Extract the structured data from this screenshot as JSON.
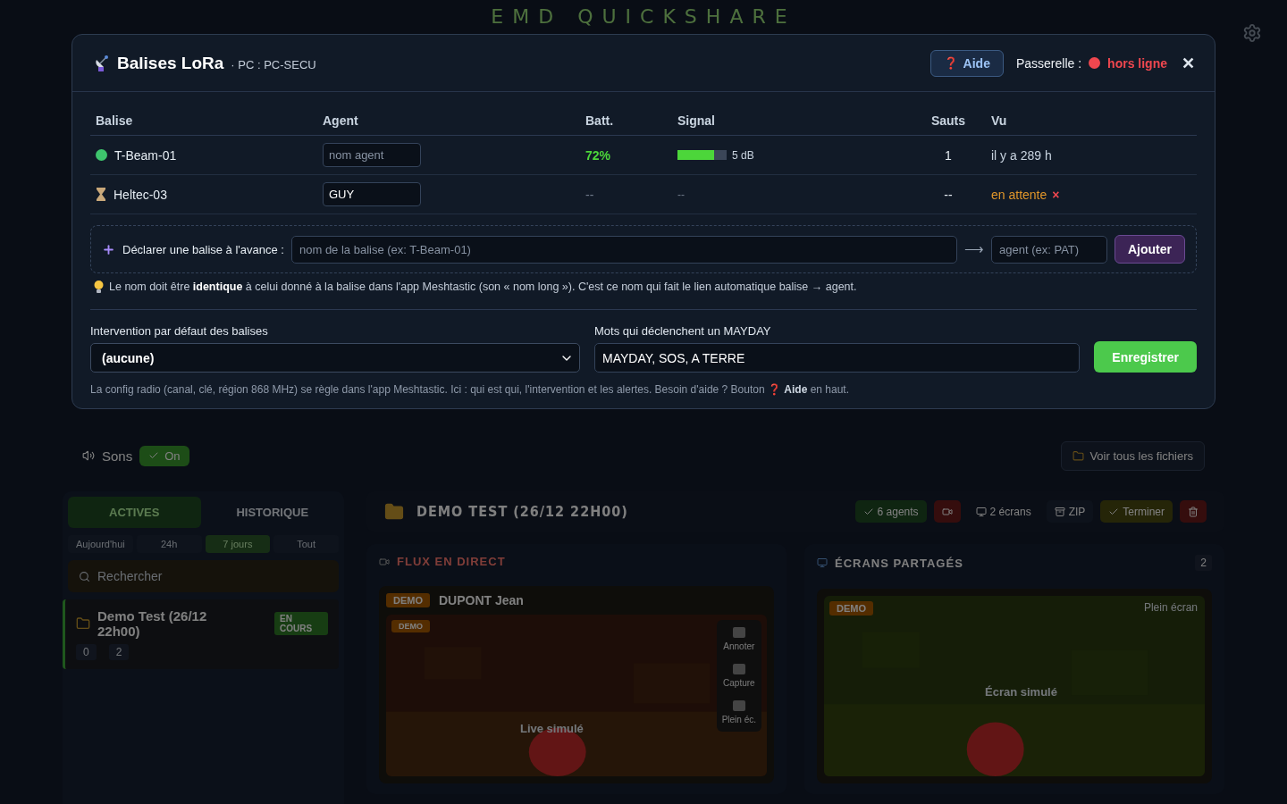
{
  "background": {
    "app_title": "EMD QUICKSHARE",
    "sounds": {
      "label": "Sons",
      "toggle": "On",
      "on": true
    },
    "files_button": "Voir tous les fichiers",
    "sidebar": {
      "tabs": [
        {
          "label": "ACTIVES",
          "selected": true
        },
        {
          "label": "HISTORIQUE",
          "selected": false
        }
      ],
      "filters": [
        {
          "label": "Aujourd'hui",
          "selected": false
        },
        {
          "label": "24h",
          "selected": false
        },
        {
          "label": "7 jours",
          "selected": true
        },
        {
          "label": "Tout",
          "selected": false
        }
      ],
      "search": {
        "placeholder": "Rechercher"
      },
      "sessions": [
        {
          "title": "Demo Test (26/12 22h00)",
          "status": "EN COURS",
          "stats": [
            "0",
            "2"
          ]
        }
      ]
    },
    "session": {
      "title": "DEMO TEST (26/12 22H00)",
      "chips": [
        {
          "kind": "agents",
          "label": "6 agents"
        },
        {
          "kind": "live"
        },
        {
          "kind": "screens",
          "label": "2 écrans"
        },
        {
          "kind": "zip",
          "label": "ZIP"
        },
        {
          "kind": "end",
          "label": "Terminer"
        },
        {
          "kind": "delete"
        }
      ],
      "live_panel": {
        "title": "FLUX EN DIRECT",
        "feed": {
          "badge": "DEMO",
          "agent": "DUPONT Jean",
          "tag": "DEMO",
          "caption": "Live simulé",
          "tools": [
            "Annoter",
            "Capture",
            "Plein éc."
          ]
        }
      },
      "screens_panel": {
        "title": "ÉCRANS PARTAGÉS",
        "count": "2",
        "screen": {
          "badge": "DEMO",
          "fullscreen": "Plein écran",
          "caption": "Écran simulé"
        }
      }
    }
  },
  "modal": {
    "title": "Balises LoRa",
    "subtitle": "· PC : PC-SECU",
    "help_button": {
      "icon": "❓",
      "label": "Aide"
    },
    "gateway": {
      "label": "Passerelle :",
      "status": "hors ligne",
      "online": false
    },
    "close": "✕",
    "table": {
      "columns": [
        "Balise",
        "Agent",
        "Batt.",
        "Signal",
        "Sauts",
        "Vu"
      ],
      "rows": [
        {
          "kind": "active",
          "name": "T-Beam-01",
          "agent": {
            "placeholder": "nom agent"
          },
          "battery": "72%",
          "signal": {
            "level": 0.75,
            "reading": "5 dB"
          },
          "hops": "1",
          "seen": "il y a 289 h"
        },
        {
          "kind": "pending",
          "name": "Heltec-03",
          "agent": {
            "value": "GUY"
          },
          "battery": "--",
          "signal": {
            "reading": "--"
          },
          "hops": "--",
          "seen": "en attente",
          "remove": "×"
        }
      ]
    },
    "declare": {
      "label": "Déclarer une balise à l'avance :",
      "name_field": {
        "placeholder": "nom de la balise (ex: T-Beam-01)"
      },
      "arrow": "⟶",
      "agent_field": {
        "placeholder": "agent (ex: PAT)"
      },
      "button": "Ajouter"
    },
    "hint": "Le nom doit être **identique** à celui donné à la balise dans l'app Meshtastic (son « nom long »). C'est ce nom qui fait le lien automatique balise → agent.",
    "intervention": {
      "label": "Intervention par défaut des balises",
      "value": "(aucune)"
    },
    "mayday": {
      "label": "Mots qui déclenchent un MAYDAY",
      "value": "MAYDAY, SOS, A TERRE"
    },
    "save_button": "Enregistrer",
    "footer_note": "La config radio (canal, clé, région 868 MHz) se règle dans l'app Meshtastic. Ici : qui est qui, l'intervention et les alertes. Besoin d'aide ? Bouton ❓ **Aide** en haut."
  }
}
